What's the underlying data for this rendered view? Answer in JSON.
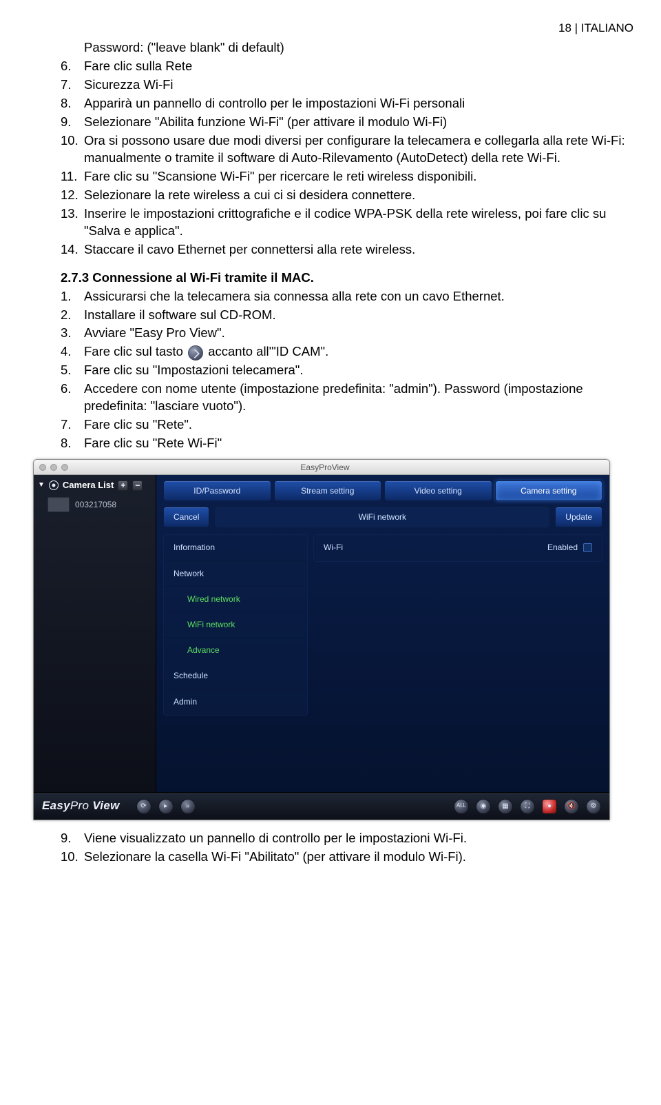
{
  "page_number": "18 | ITALIANO",
  "top_items": [
    {
      "num": "",
      "text": "Password: (\"leave blank\" di default)"
    },
    {
      "num": "6.",
      "text": "Fare clic sulla Rete"
    },
    {
      "num": "7.",
      "text": "Sicurezza Wi-Fi"
    },
    {
      "num": "8.",
      "text": "Apparirà un pannello di controllo per le impostazioni Wi-Fi personali"
    },
    {
      "num": "9.",
      "text": "Selezionare \"Abilita funzione Wi-Fi\" (per attivare il modulo Wi-Fi)"
    },
    {
      "num": "10.",
      "text": "Ora si possono usare due modi diversi per configurare la telecamera e collegarla alla rete Wi-Fi: manualmente o tramite il software di Auto-Rilevamento (AutoDetect) della rete Wi-Fi."
    },
    {
      "num": "11.",
      "text": "Fare clic su \"Scansione Wi-Fi\" per ricercare le reti wireless disponibili."
    },
    {
      "num": "12.",
      "text": "Selezionare la rete wireless a cui ci si desidera connettere."
    },
    {
      "num": "13.",
      "text": "Inserire le impostazioni crittografiche e il codice WPA-PSK della rete wireless, poi fare clic su \"Salva e applica\"."
    },
    {
      "num": "14.",
      "text": "Staccare il cavo Ethernet per connettersi alla rete wireless."
    }
  ],
  "section_title": "2.7.3 Connessione al Wi-Fi tramite il MAC.",
  "mac_items": [
    {
      "num": "1.",
      "text": "Assicurarsi che la telecamera sia connessa alla rete con un cavo Ethernet."
    },
    {
      "num": "2.",
      "text": "Installare il software sul CD-ROM."
    },
    {
      "num": "3.",
      "text": "Avviare \"Easy Pro View\"."
    },
    {
      "num": "4.",
      "pre": "Fare clic sul tasto ",
      "post": " accanto all'\"ID CAM\"."
    },
    {
      "num": "5.",
      "text": "Fare clic su \"Impostazioni telecamera\"."
    },
    {
      "num": "6.",
      "text": "Accedere con nome utente (impostazione predefinita: \"admin\"). Password (impostazione predefinita: \"lasciare vuoto\")."
    },
    {
      "num": "7.",
      "text": "Fare clic su \"Rete\"."
    },
    {
      "num": "8.",
      "text": "Fare clic su \"Rete Wi-Fi\""
    }
  ],
  "app": {
    "window_title": "EasyProView",
    "sidebar_title": "Camera List",
    "camera_id": "003217058",
    "tabs": [
      "ID/Password",
      "Stream setting",
      "Video setting",
      "Camera setting"
    ],
    "cancel": "Cancel",
    "panel_title": "WiFi network",
    "update": "Update",
    "nav": [
      "Information",
      "Network",
      "Wired network",
      "WiFi network",
      "Advance",
      "Schedule",
      "Admin"
    ],
    "detail_label": "Wi-Fi",
    "enabled_label": "Enabled",
    "brand1": "Easy",
    "brand2": "Pro ",
    "brand3": "View"
  },
  "post_items": [
    {
      "num": "9.",
      "text": "Viene visualizzato un pannello di controllo per le impostazioni Wi-Fi."
    },
    {
      "num": "10.",
      "text": "Selezionare la casella Wi-Fi \"Abilitato\" (per attivare il modulo Wi-Fi)."
    }
  ]
}
